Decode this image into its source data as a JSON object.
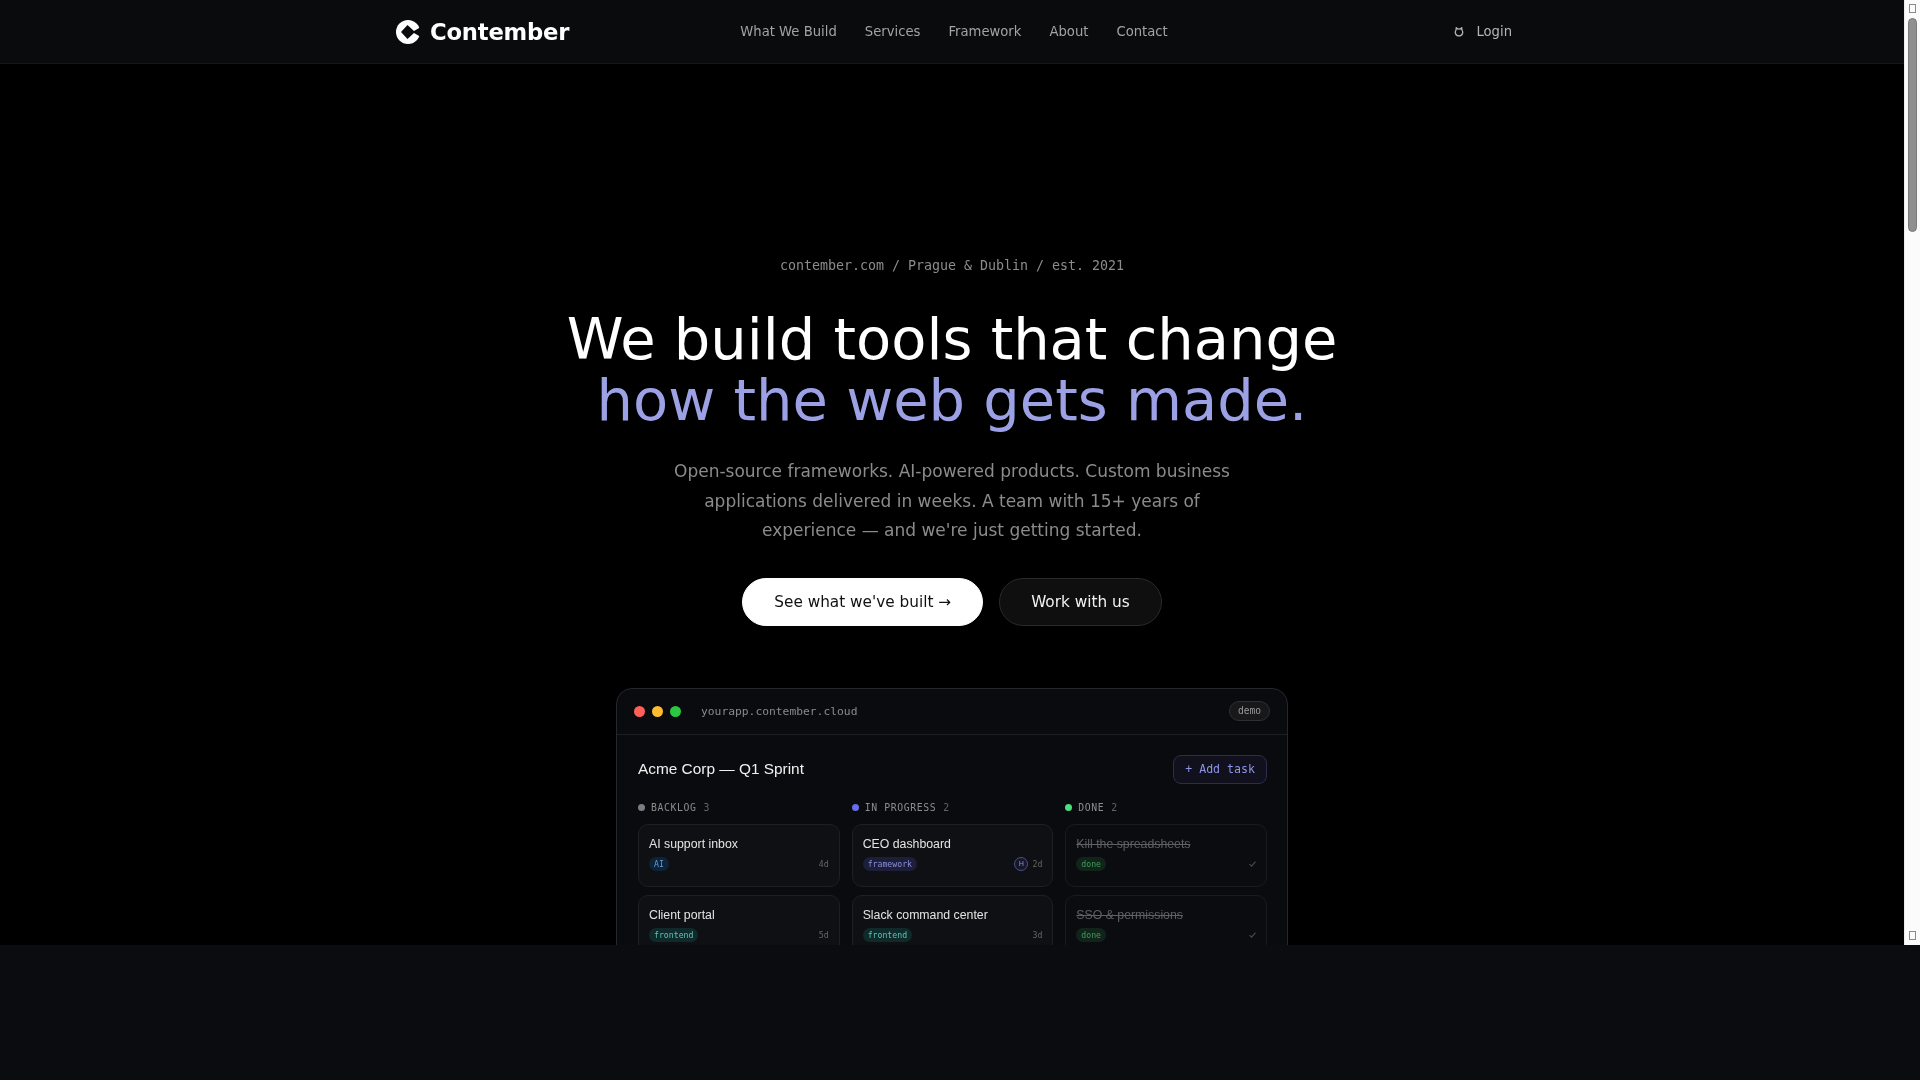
{
  "header": {
    "logo": "Contember",
    "nav": [
      "What We Build",
      "Services",
      "Framework",
      "About",
      "Contact"
    ],
    "login": "Login"
  },
  "hero": {
    "tagline": "contember.com / Prague & Dublin / est. 2021",
    "headline": "We build tools that change",
    "headline_accent": "how the web gets made.",
    "description": "Open-source frameworks. AI-powered products. Custom business applications delivered in weeks. A team with 15+ years of experience — and we're just getting started.",
    "buttons": [
      {
        "label": "See what we've built →",
        "kind": "primary"
      },
      {
        "label": "Work with us",
        "kind": "secondary"
      }
    ]
  },
  "demo": {
    "url": "yourapp.contember.cloud",
    "badge": "demo",
    "title": "Acme Corp — Q1 Sprint",
    "add_button": "+ Add task",
    "columns": [
      {
        "name": "BACKLOG",
        "count": "3",
        "color": "#7c7c84",
        "cards": [
          {
            "title": "AI support inbox",
            "tag": {
              "label": "AI",
              "kind": "ai"
            },
            "age": "4d",
            "done": false
          },
          {
            "title": "Client portal",
            "tag": {
              "label": "frontend",
              "kind": "frontend"
            },
            "age": "5d",
            "done": false
          }
        ]
      },
      {
        "name": "IN PROGRESS",
        "count": "2",
        "color": "#6670e6",
        "cards": [
          {
            "title": "CEO dashboard",
            "tag": {
              "label": "framework",
              "kind": "framework"
            },
            "assignee": "H",
            "age": "2d",
            "done": false
          },
          {
            "title": "Slack command center",
            "tag": {
              "label": "frontend",
              "kind": "frontend"
            },
            "age": "3d",
            "done": false
          }
        ]
      },
      {
        "name": "DONE",
        "count": "2",
        "color": "#4ade80",
        "cards": [
          {
            "title": "Kill the spreadsheets",
            "tag": {
              "label": "done",
              "kind": "done"
            },
            "done": true
          },
          {
            "title": "SSO & permissions",
            "tag": {
              "label": "done",
              "kind": "done"
            },
            "done": true
          }
        ]
      }
    ]
  }
}
